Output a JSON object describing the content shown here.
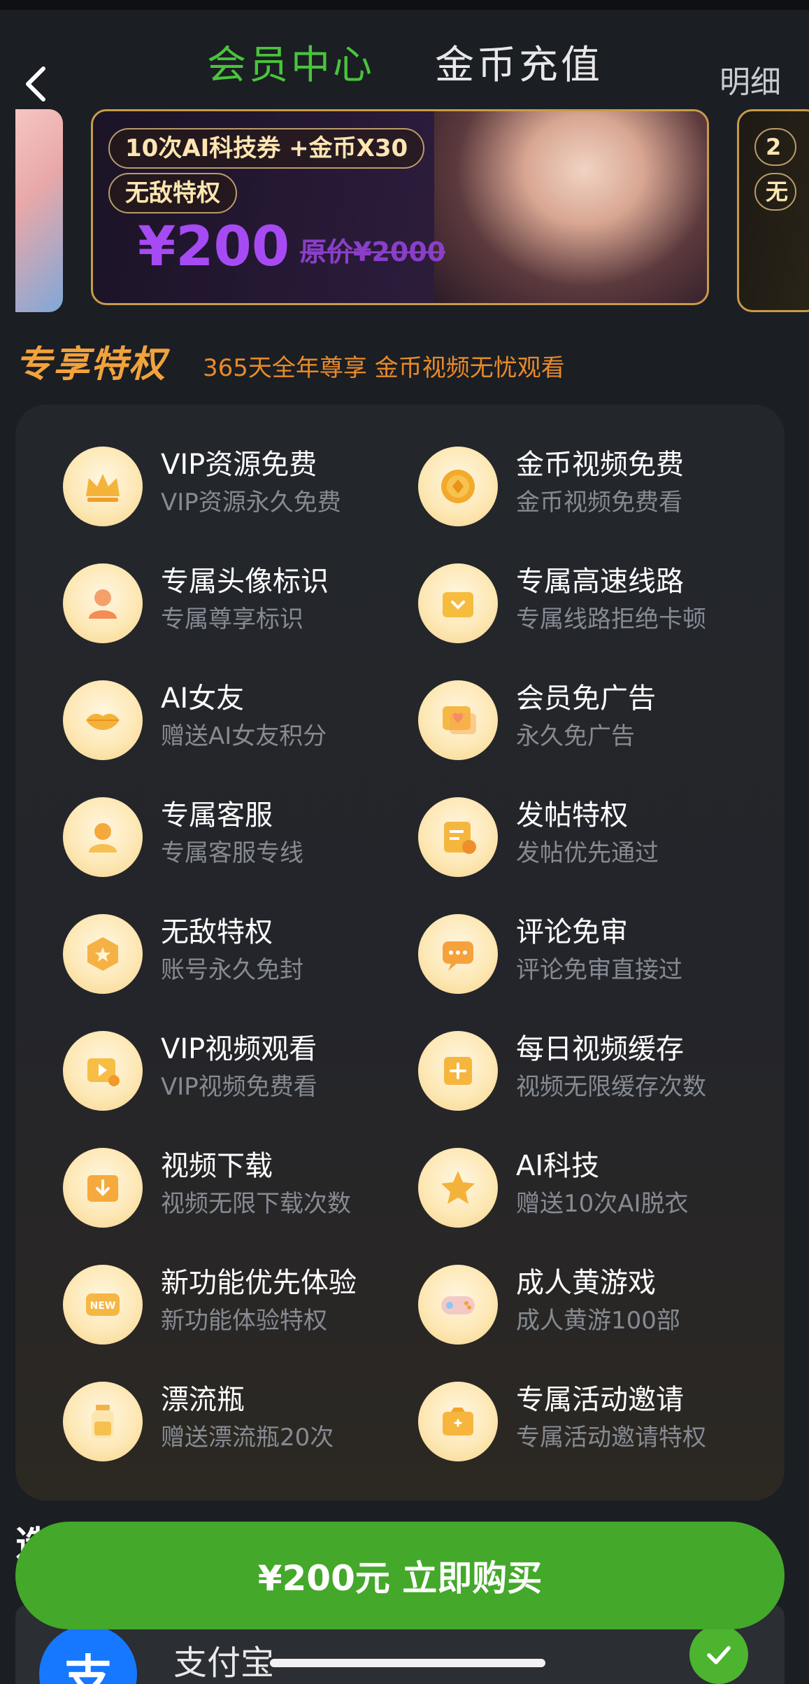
{
  "header": {
    "tabs": [
      {
        "label": "会员中心",
        "active": true
      },
      {
        "label": "金币充值",
        "active": false
      }
    ],
    "detail_link": "明细",
    "back_icon": "chevron-left-icon"
  },
  "banner": {
    "pill_1": "10次AI科技券 +金币X30",
    "pill_2": "无敌特权",
    "price": "¥200",
    "original_price": "原价¥2000",
    "right_pill_1": "2",
    "right_pill_2": "无"
  },
  "privileges": {
    "heading": "专享特权",
    "subheading": "365天全年尊享 金币视频无忧观看",
    "items": [
      {
        "title": "VIP资源免费",
        "desc": "VIP资源永久免费",
        "icon": "crown-icon"
      },
      {
        "title": "金币视频免费",
        "desc": "金币视频免费看",
        "icon": "coin-icon"
      },
      {
        "title": "专属头像标识",
        "desc": "专属尊享标识",
        "icon": "avatar-icon"
      },
      {
        "title": "专属高速线路",
        "desc": "专属线路拒绝卡顿",
        "icon": "folder-down-icon"
      },
      {
        "title": "AI女友",
        "desc": "赠送AI女友积分",
        "icon": "lips-icon"
      },
      {
        "title": "会员免广告",
        "desc": "永久免广告",
        "icon": "heart-chat-icon"
      },
      {
        "title": "专属客服",
        "desc": "专属客服专线",
        "icon": "person-icon"
      },
      {
        "title": "发帖特权",
        "desc": "发帖优先通过",
        "icon": "post-icon"
      },
      {
        "title": "无敌特权",
        "desc": "账号永久免封",
        "icon": "shield-star-icon"
      },
      {
        "title": "评论免审",
        "desc": "评论免审直接过",
        "icon": "comment-icon"
      },
      {
        "title": "VIP视频观看",
        "desc": "VIP视频免费看",
        "icon": "play-video-icon"
      },
      {
        "title": "每日视频缓存",
        "desc": "视频无限缓存次数",
        "icon": "cache-plus-icon"
      },
      {
        "title": "视频下载",
        "desc": "视频无限下载次数",
        "icon": "download-box-icon"
      },
      {
        "title": "AI科技",
        "desc": "赠送10次AI脱衣",
        "icon": "star-icon"
      },
      {
        "title": "新功能优先体验",
        "desc": "新功能体验特权",
        "icon": "new-badge-icon"
      },
      {
        "title": "成人黄游戏",
        "desc": "成人黄游100部",
        "icon": "gamepad-icon"
      },
      {
        "title": "漂流瓶",
        "desc": "赠送漂流瓶20次",
        "icon": "bottle-icon"
      },
      {
        "title": "专属活动邀请",
        "desc": "专属活动邀请特权",
        "icon": "invitation-icon"
      }
    ]
  },
  "purchase": {
    "button_label": "¥200元 立即购买",
    "partial_heading": "选"
  },
  "payment": {
    "method_label": "支付宝",
    "method_icon_glyph": "支",
    "selected": true
  },
  "colors": {
    "accent_green": "#49c43c",
    "button_green": "#44a82b",
    "privilege_orange": "#f2a23c",
    "price_purple": "#a64bf4",
    "alipay_blue": "#1677ff"
  }
}
